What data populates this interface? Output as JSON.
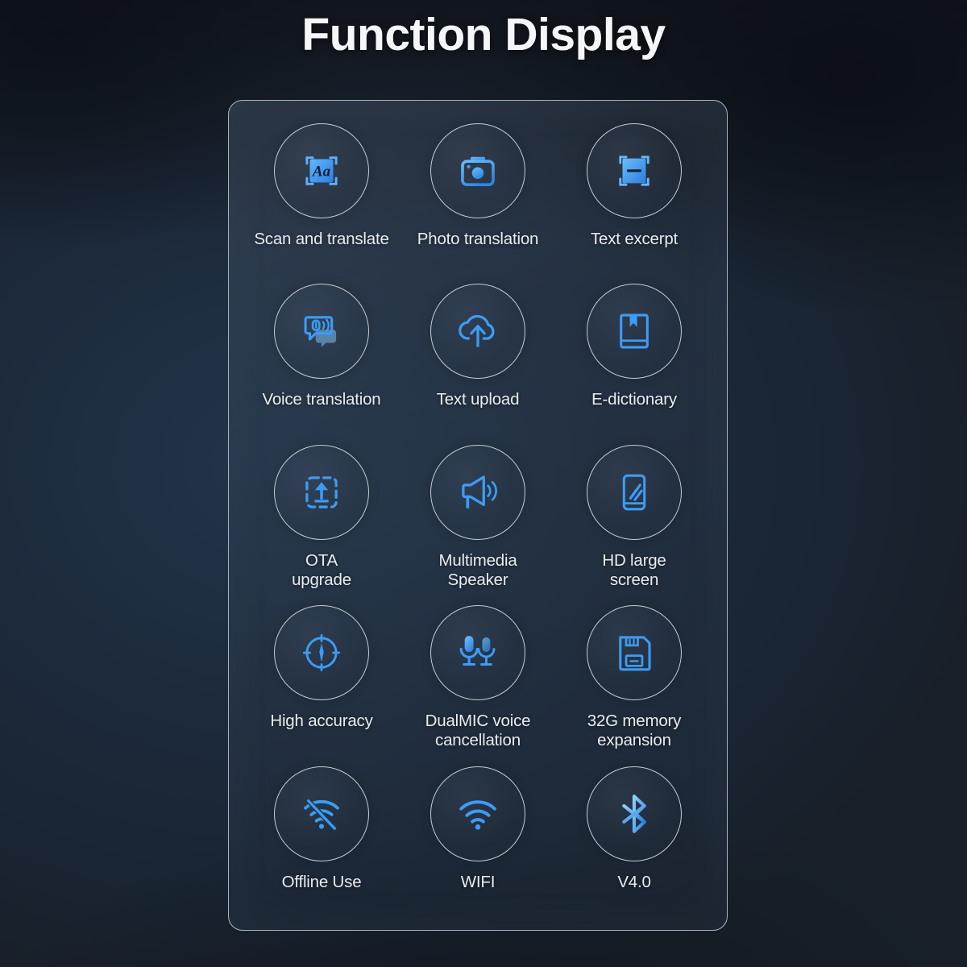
{
  "page": {
    "title": "Function Display",
    "background_color": "#1b2635",
    "panel_border_color": "#aab4c0",
    "icon_accent_color": "#3d9cf5",
    "label_color": "#e9edf1"
  },
  "features": [
    {
      "id": "scan-and-translate",
      "label": "Scan and translate",
      "icon": "scan-text-aa-icon"
    },
    {
      "id": "photo-translation",
      "label": "Photo translation",
      "icon": "camera-icon"
    },
    {
      "id": "text-excerpt",
      "label": "Text excerpt",
      "icon": "scan-excerpt-icon"
    },
    {
      "id": "voice-translation",
      "label": "Voice translation",
      "icon": "speech-bubble-voice-icon"
    },
    {
      "id": "text-upload",
      "label": "Text upload",
      "icon": "cloud-upload-icon"
    },
    {
      "id": "e-dictionary",
      "label": "E-dictionary",
      "icon": "book-bookmark-icon"
    },
    {
      "id": "ota-upgrade",
      "label": "OTA\nupgrade",
      "icon": "dashed-box-upload-icon"
    },
    {
      "id": "multimedia-speaker",
      "label": "Multimedia\nSpeaker",
      "icon": "megaphone-icon"
    },
    {
      "id": "hd-large-screen",
      "label": "HD large\nscreen",
      "icon": "phone-screen-icon"
    },
    {
      "id": "high-accuracy",
      "label": "High accuracy",
      "icon": "crosshair-target-icon"
    },
    {
      "id": "dualmic-voice",
      "label": "DualMIC voice\ncancellation",
      "icon": "dual-microphone-icon"
    },
    {
      "id": "memory-expansion",
      "label": "32G memory\nexpansion",
      "icon": "floppy-disk-icon"
    },
    {
      "id": "offline-use",
      "label": "Offline Use",
      "icon": "wifi-off-icon"
    },
    {
      "id": "wifi",
      "label": "WIFI",
      "icon": "wifi-icon"
    },
    {
      "id": "bluetooth-version",
      "label": "V4.0",
      "icon": "bluetooth-icon"
    }
  ]
}
